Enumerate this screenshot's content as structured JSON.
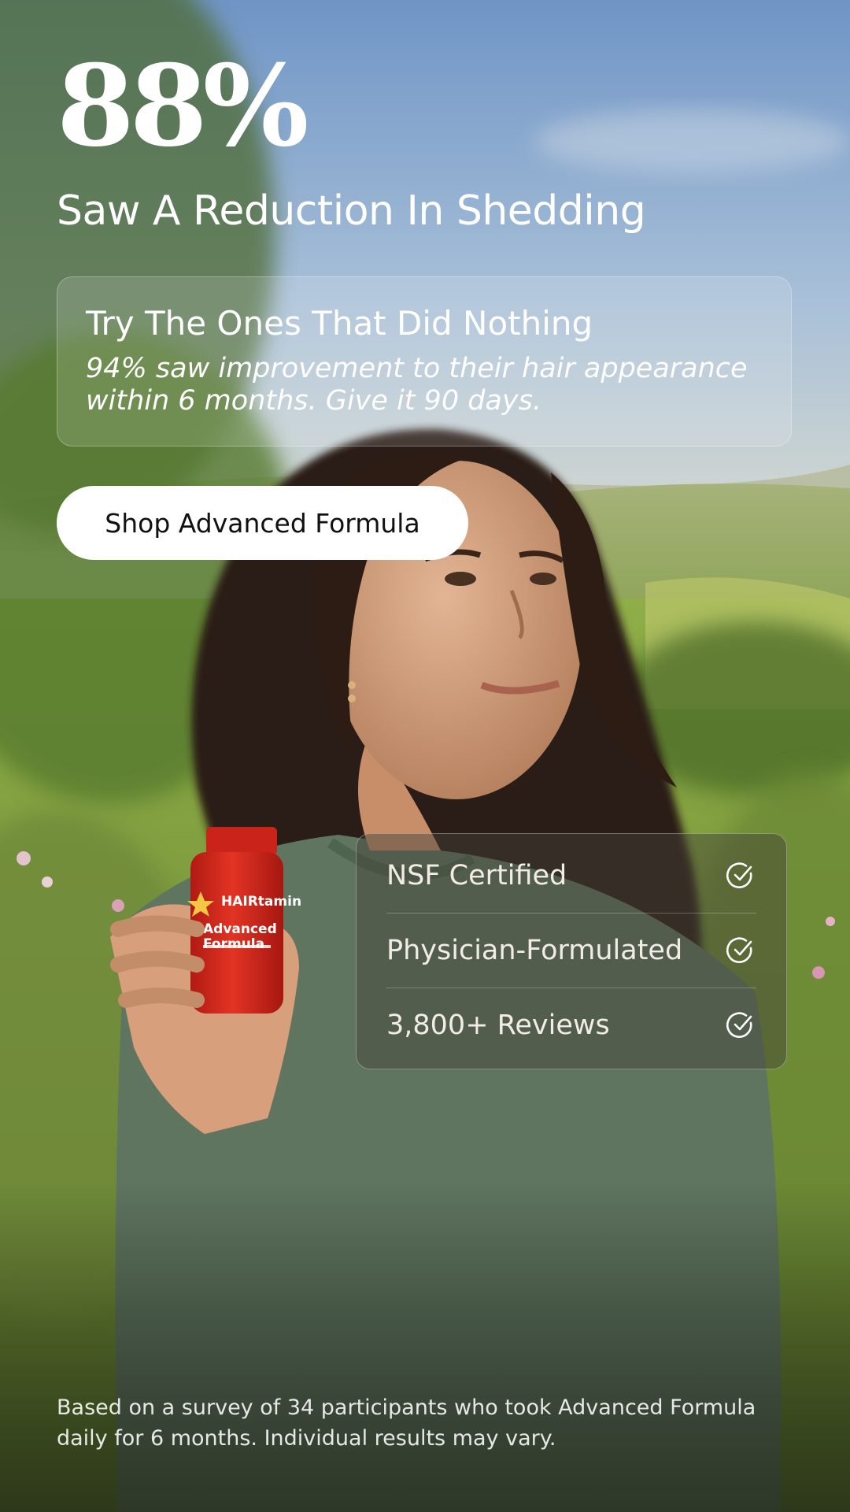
{
  "stat": {
    "value": "88%"
  },
  "headline": "Saw A Reduction In Shedding",
  "promo": {
    "title": "Try The Ones That Did Nothing",
    "body": "94% saw improvement to their hair appearance within 6 months. Give it 90 days."
  },
  "cta": {
    "label": "Shop Advanced Formula"
  },
  "badges": [
    {
      "label": "NSF Certified",
      "icon": "check-circle-icon"
    },
    {
      "label": "Physician-Formulated",
      "icon": "check-circle-icon"
    },
    {
      "label": "3,800+ Reviews",
      "icon": "check-circle-icon"
    }
  ],
  "product": {
    "brand": "HAIRtamin",
    "name_line1": "Advanced",
    "name_line2": "Formula"
  },
  "disclaimer": "Based on a survey of 34 participants who took Advanced Formula daily for 6 months. Individual results may vary.",
  "colors": {
    "sky": "#7fa3cf",
    "meadow": "#8ea64e",
    "sweater": "#5f7560",
    "bottle": "#d8281c",
    "cta_bg": "#ffffff"
  }
}
